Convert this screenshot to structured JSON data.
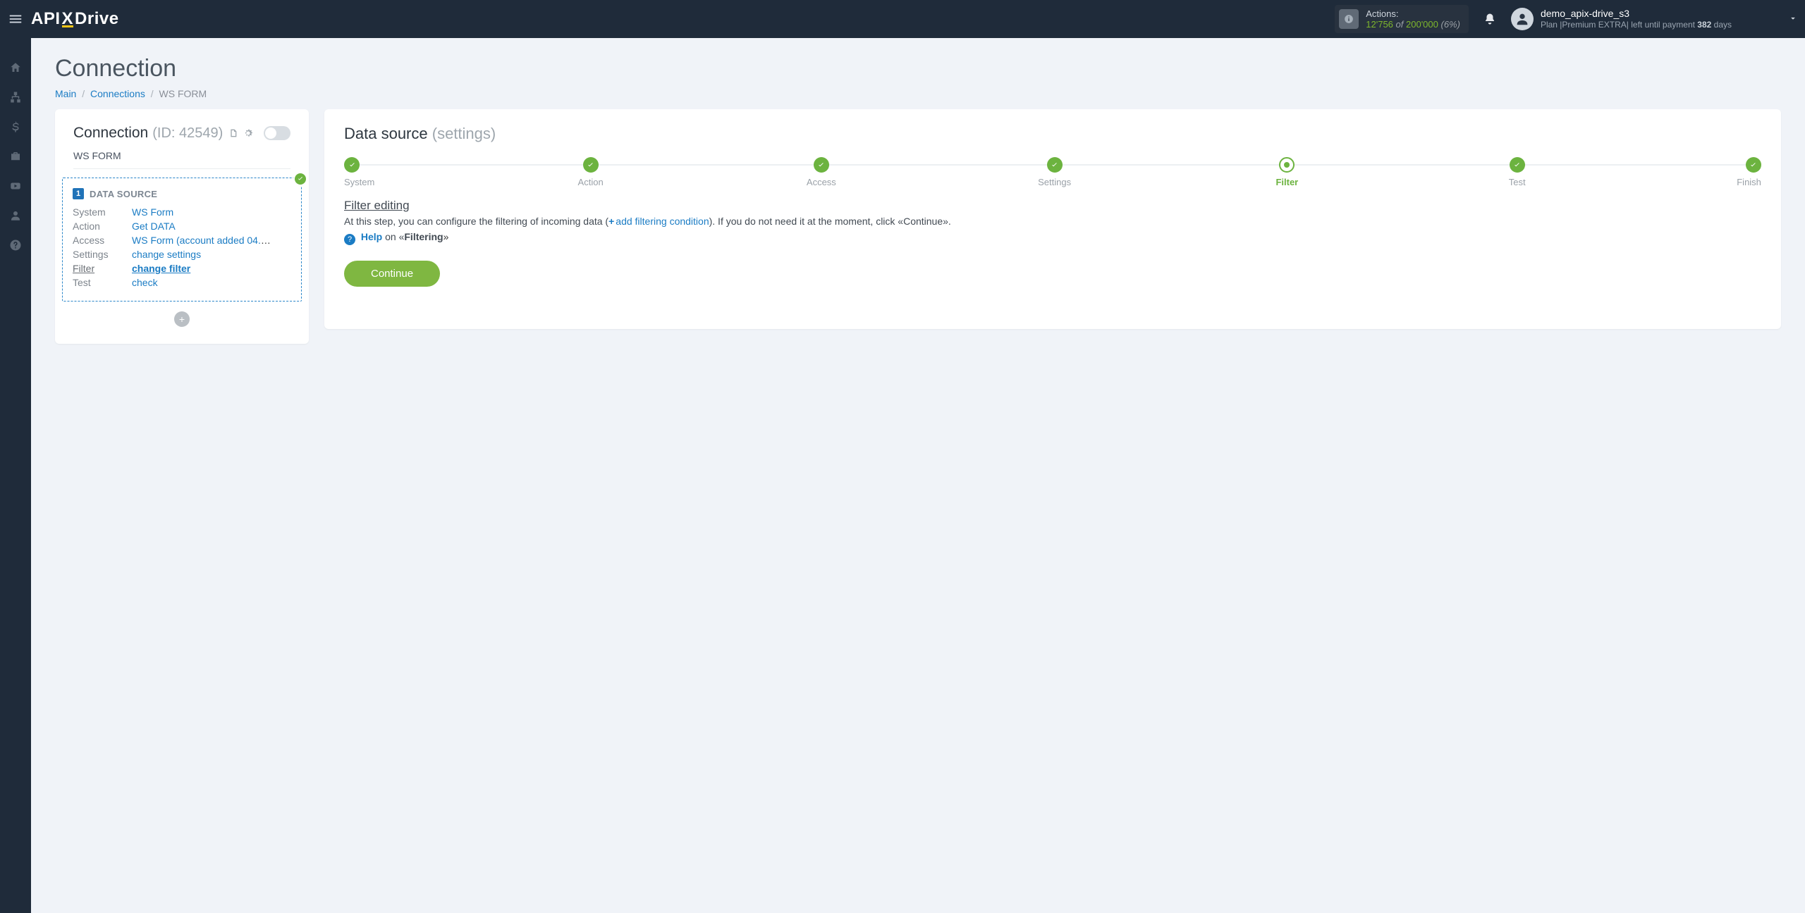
{
  "header": {
    "actions_label": "Actions:",
    "actions_used": "12'756",
    "actions_of": "of",
    "actions_total": "200'000",
    "actions_pct": "(6%)",
    "user_name": "demo_apix-drive_s3",
    "plan_prefix": "Plan  |",
    "plan_name": "Premium EXTRA",
    "plan_mid": "|  left until payment ",
    "plan_days": "382",
    "plan_suffix": " days"
  },
  "page": {
    "title": "Connection",
    "crumb_main": "Main",
    "crumb_connections": "Connections",
    "crumb_current": "WS FORM"
  },
  "connectionCard": {
    "title": "Connection",
    "id_label": "(ID: 42549)",
    "name": "WS FORM",
    "ds_badge": "1",
    "ds_title": "DATA SOURCE",
    "rows": {
      "system_lbl": "System",
      "system_val": "WS Form",
      "action_lbl": "Action",
      "action_val": "Get DATA",
      "access_lbl": "Access",
      "access_val": "WS Form (account added 04.0…",
      "settings_lbl": "Settings",
      "settings_val": "change settings",
      "filter_lbl": "Filter",
      "filter_val": "change filter",
      "test_lbl": "Test",
      "test_val": "check"
    }
  },
  "dataSourcePanel": {
    "title": "Data source",
    "title_suffix": "(settings)",
    "steps": [
      "System",
      "Action",
      "Access",
      "Settings",
      "Filter",
      "Test",
      "Finish"
    ],
    "active_step_index": 4,
    "section_title": "Filter editing",
    "desc_before": "At this step, you can configure the filtering of incoming data (",
    "add_link": "add filtering condition",
    "desc_after": "). If you do not need it at the moment, click «Continue».",
    "help_label": "Help",
    "help_on": " on «",
    "help_topic": "Filtering",
    "help_close": "»",
    "continue": "Continue"
  }
}
